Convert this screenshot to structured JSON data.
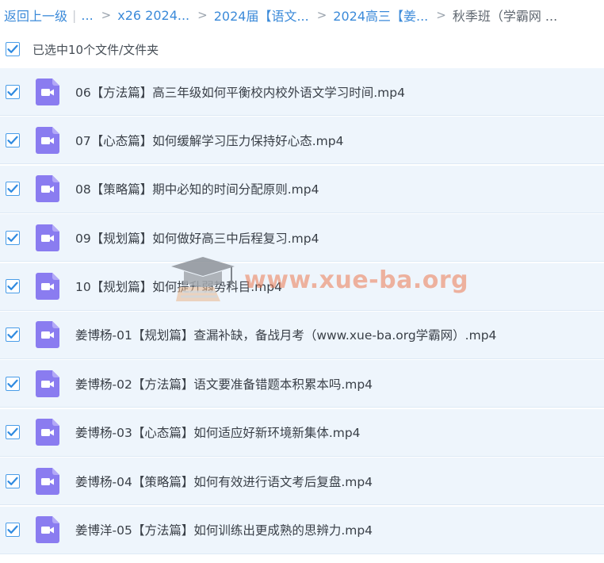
{
  "breadcrumb": {
    "back": "返回上一级",
    "pipe": "|",
    "ellipsis": "...",
    "sep": ">",
    "items": [
      "x26 2024...",
      "2024届【语文...",
      "2024高三【姜..."
    ],
    "current": "秋季班（学霸网 ..."
  },
  "selection": {
    "label": "已选中10个文件/文件夹",
    "checked": true
  },
  "files": [
    {
      "name": "06【方法篇】高三年级如何平衡校内校外语文学习时间.mp4",
      "checked": true,
      "icon": "video-file-icon"
    },
    {
      "name": "07【心态篇】如何缓解学习压力保持好心态.mp4",
      "checked": true,
      "icon": "video-file-icon"
    },
    {
      "name": "08【策略篇】期中必知的时间分配原则.mp4",
      "checked": true,
      "icon": "video-file-icon"
    },
    {
      "name": "09【规划篇】如何做好高三中后程复习.mp4",
      "checked": true,
      "icon": "video-file-icon"
    },
    {
      "name": "10【规划篇】如何提升弱势科目.mp4",
      "checked": true,
      "icon": "video-file-icon"
    },
    {
      "name": "姜博杨-01【规划篇】查漏补缺，备战月考（www.xue-ba.org学霸网）.mp4",
      "checked": true,
      "icon": "video-file-icon"
    },
    {
      "name": "姜博杨-02【方法篇】语文要准备错题本积累本吗.mp4",
      "checked": true,
      "icon": "video-file-icon"
    },
    {
      "name": "姜博杨-03【心态篇】如何适应好新环境新集体.mp4",
      "checked": true,
      "icon": "video-file-icon"
    },
    {
      "name": "姜博杨-04【策略篇】如何有效进行语文考后复盘.mp4",
      "checked": true,
      "icon": "video-file-icon"
    },
    {
      "name": "姜博洋-05【方法篇】如何训练出更成熟的思辨力.mp4",
      "checked": true,
      "icon": "video-file-icon"
    }
  ],
  "watermark": {
    "text": "www.xue-ba.org"
  },
  "colors": {
    "link": "#3b8ad9",
    "checkbox": "#4a9de8",
    "row_bg": "#eef5fc",
    "video_icon": "#8a7cf0"
  }
}
